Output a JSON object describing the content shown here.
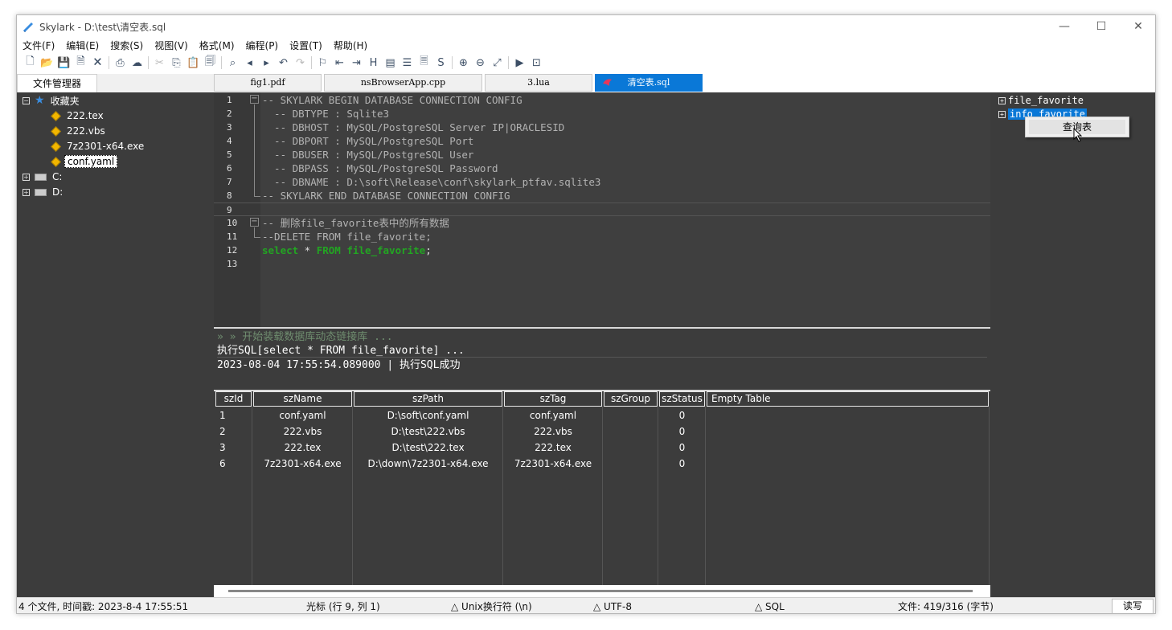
{
  "window": {
    "title": "Skylark - D:\\test\\清空表.sql",
    "controls": {
      "minimize": "—",
      "maximize": "☐",
      "close": "✕"
    }
  },
  "menu": [
    "文件(F)",
    "编辑(E)",
    "搜索(S)",
    "视图(V)",
    "格式(M)",
    "编程(P)",
    "设置(T)",
    "帮助(H)"
  ],
  "toolbar": [
    {
      "icon": "new-file-icon",
      "glyph": "🗋",
      "enabled": true
    },
    {
      "icon": "open-folder-icon",
      "glyph": "📂",
      "enabled": true
    },
    {
      "icon": "save-icon",
      "glyph": "💾",
      "enabled": true
    },
    {
      "icon": "save-as-icon",
      "glyph": "🗎",
      "enabled": true
    },
    {
      "icon": "close-file-icon",
      "glyph": "🗙",
      "enabled": true
    },
    {
      "sep": true
    },
    {
      "icon": "print-icon",
      "glyph": "⎙",
      "enabled": true
    },
    {
      "icon": "cloud-icon",
      "glyph": "☁",
      "enabled": true
    },
    {
      "sep": true
    },
    {
      "icon": "cut-icon",
      "glyph": "✂",
      "enabled": false
    },
    {
      "icon": "copy-icon",
      "glyph": "⎘",
      "enabled": true
    },
    {
      "icon": "paste-icon",
      "glyph": "📋",
      "enabled": true
    },
    {
      "icon": "clipboard-icon",
      "glyph": "🗐",
      "enabled": true
    },
    {
      "sep": true
    },
    {
      "icon": "search-icon",
      "glyph": "⌕",
      "enabled": true
    },
    {
      "icon": "find-prev-icon",
      "glyph": "◂",
      "enabled": true
    },
    {
      "icon": "find-next-icon",
      "glyph": "▸",
      "enabled": true
    },
    {
      "icon": "undo-icon",
      "glyph": "↶",
      "enabled": true
    },
    {
      "icon": "redo-icon",
      "glyph": "↷",
      "enabled": false
    },
    {
      "sep": true
    },
    {
      "icon": "bookmark-icon",
      "glyph": "⚐",
      "enabled": true
    },
    {
      "icon": "bookmark-prev-icon",
      "glyph": "⇤",
      "enabled": true
    },
    {
      "icon": "bookmark-next-icon",
      "glyph": "⇥",
      "enabled": true
    },
    {
      "icon": "hex-icon",
      "glyph": "H",
      "enabled": true
    },
    {
      "icon": "column-icon",
      "glyph": "▤",
      "enabled": true
    },
    {
      "icon": "indent-icon",
      "glyph": "☰",
      "enabled": true
    },
    {
      "icon": "document-icon",
      "glyph": "🗏",
      "enabled": true
    },
    {
      "icon": "s-icon",
      "glyph": "S",
      "enabled": true
    },
    {
      "sep": true
    },
    {
      "icon": "zoom-in-icon",
      "glyph": "⊕",
      "enabled": true
    },
    {
      "icon": "zoom-out-icon",
      "glyph": "⊖",
      "enabled": true
    },
    {
      "icon": "fullscreen-icon",
      "glyph": "⤢",
      "enabled": true
    },
    {
      "sep": true
    },
    {
      "icon": "run-icon",
      "glyph": "▶",
      "enabled": true
    },
    {
      "icon": "terminal-icon",
      "glyph": "⊡",
      "enabled": true
    }
  ],
  "left_tab": "文件管理器",
  "doc_tabs": [
    "fig1.pdf",
    "nsBrowserApp.cpp",
    "3.lua",
    "清空表.sql"
  ],
  "sidebar": {
    "favorites": "收藏夹",
    "files": [
      "222.tex",
      "222.vbs",
      "7z2301-x64.exe",
      "conf.yaml"
    ],
    "drives": [
      "C:",
      "D:"
    ]
  },
  "editor": {
    "lines": [
      {
        "n": "1",
        "code": "-- SKYLARK BEGIN DATABASE CONNECTION CONFIG"
      },
      {
        "n": "2",
        "code": "  -- DBTYPE : Sqlite3"
      },
      {
        "n": "3",
        "code": "  -- DBHOST : MySQL/PostgreSQL Server IP|ORACLESID"
      },
      {
        "n": "4",
        "code": "  -- DBPORT : MySQL/PostgreSQL Port"
      },
      {
        "n": "5",
        "code": "  -- DBUSER : MySQL/PostgreSQL User"
      },
      {
        "n": "6",
        "code": "  -- DBPASS : MySQL/PostgreSQL Password"
      },
      {
        "n": "7",
        "code": "  -- DBNAME : D:\\soft\\Release\\conf\\skylark_ptfav.sqlite3"
      },
      {
        "n": "8",
        "code": "-- SKYLARK END DATABASE CONNECTION CONFIG"
      },
      {
        "n": "9",
        "code": ""
      },
      {
        "n": "10",
        "code": "-- 删除file_favorite表中的所有数据"
      },
      {
        "n": "11",
        "code": "--DELETE FROM file_favorite;"
      },
      {
        "n": "12",
        "code": ""
      },
      {
        "n": "13",
        "code": ""
      }
    ],
    "line12": {
      "kw1": "select",
      "star": " * ",
      "kw2": "FROM",
      "table": " file_favorite",
      "end": ";"
    }
  },
  "output": {
    "lines": [
      "» » 开始装载数据库动态链接库 ...",
      "执行SQL[select * FROM file_favorite] ...",
      "2023-08-04 17:55:54.089000 | 执行SQL成功"
    ]
  },
  "grid": {
    "headers": [
      "szId",
      "szName",
      "szPath",
      "szTag",
      "szGroup",
      "szStatus",
      "Empty Table"
    ],
    "rows": [
      [
        "1",
        "conf.yaml",
        "D:\\soft\\conf.yaml",
        "conf.yaml",
        "",
        "0"
      ],
      [
        "2",
        "222.vbs",
        "D:\\test\\222.vbs",
        "222.vbs",
        "",
        "0"
      ],
      [
        "3",
        "222.tex",
        "D:\\test\\222.tex",
        "222.tex",
        "",
        "0"
      ],
      [
        "6",
        "7z2301-x64.exe",
        "D:\\down\\7z2301-x64.exe",
        "7z2301-x64.exe",
        "",
        "0"
      ]
    ]
  },
  "rightpanel": {
    "items": [
      "file_favorite",
      "info_favorite"
    ],
    "context_menu": "查询表"
  },
  "status": {
    "files": "4 个文件, 时间戳: 2023-8-4 17:55:51",
    "cursor": "光标 (行 9, 列 1)",
    "eol": "△ Unix换行符 (\\n)",
    "encoding": "△ UTF-8",
    "lang": "△ SQL",
    "size": "文件: 419/316 (字节)",
    "mode": "读写"
  },
  "colors": {
    "accent": "#0a78d7",
    "editor_bg": "#3f3f3f",
    "panel_bg": "#3c3c3c",
    "keyword": "#22a522",
    "comment": "#b3b3b3"
  }
}
